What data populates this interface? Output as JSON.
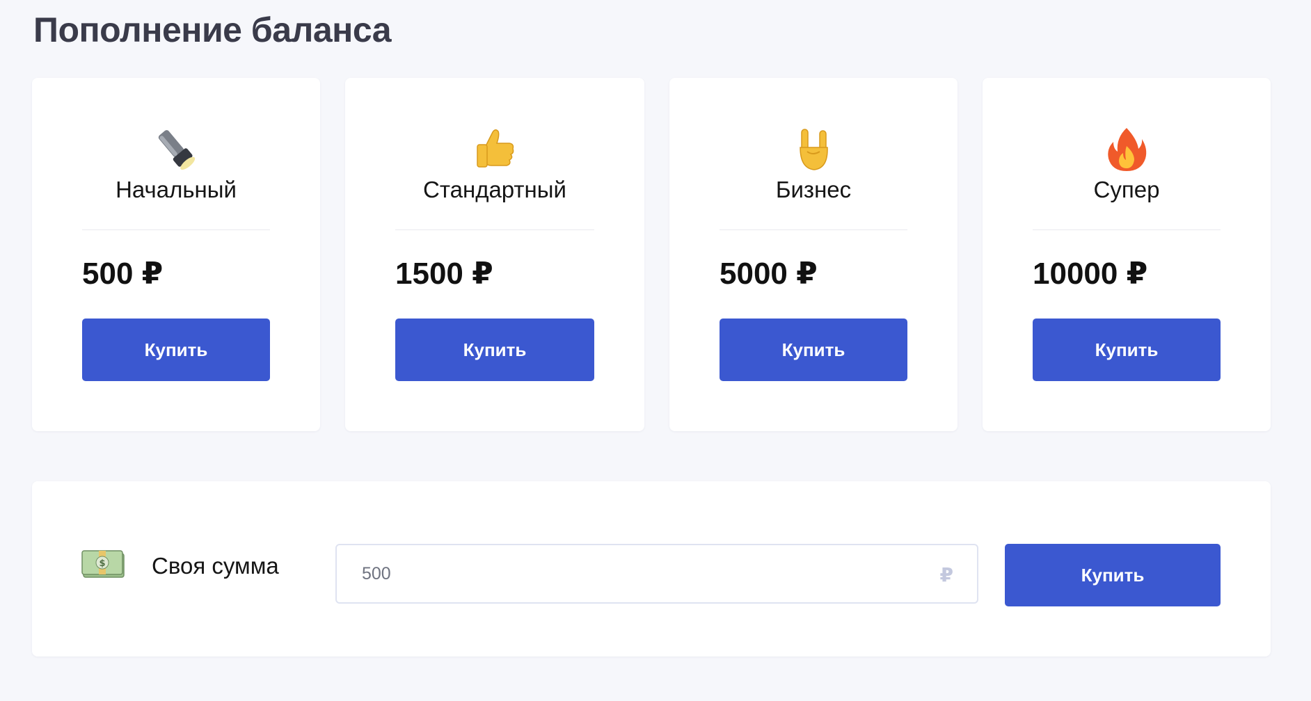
{
  "page": {
    "title": "Пополнение баланса"
  },
  "plans": [
    {
      "icon": "flashlight-icon",
      "name": "Начальный",
      "price": "500 ₽",
      "button_label": "Купить"
    },
    {
      "icon": "thumbs-up-icon",
      "name": "Стандартный",
      "price": "1500 ₽",
      "button_label": "Купить"
    },
    {
      "icon": "rock-on-hand-icon",
      "name": "Бизнес",
      "price": "5000 ₽",
      "button_label": "Купить"
    },
    {
      "icon": "fire-icon",
      "name": "Супер",
      "price": "10000 ₽",
      "button_label": "Купить"
    }
  ],
  "custom": {
    "icon": "money-banknote-icon",
    "label": "Своя сумма",
    "placeholder": "500",
    "currency": "₽",
    "button_label": "Купить"
  },
  "colors": {
    "background": "#f6f7fb",
    "card": "#ffffff",
    "accent": "#3b58d0",
    "title": "#3a3b4a"
  }
}
